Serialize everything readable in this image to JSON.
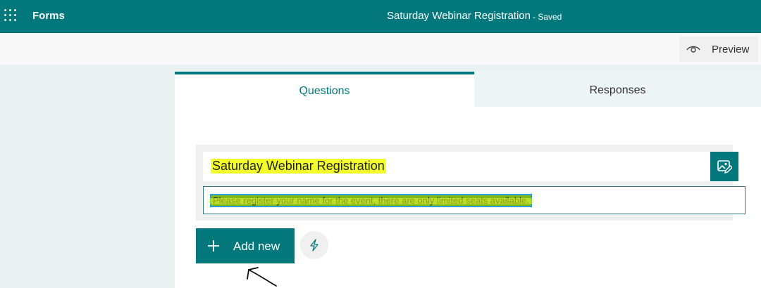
{
  "topbar": {
    "app_name": "Forms",
    "form_title": "Saturday Webinar Registration",
    "status": "- Saved",
    "bg_color": "#03787c",
    "icons": {
      "app_launcher": "waffle-icon"
    }
  },
  "commandbar": {
    "preview_label": "Preview",
    "icons": {
      "preview": "eye-icon"
    }
  },
  "tabs": [
    {
      "label": "Questions",
      "active": true
    },
    {
      "label": "Responses",
      "active": false
    }
  ],
  "form_header": {
    "title": "Saturday Webinar Registration",
    "description": "Please register your name for the event, there are only limited seats available.",
    "theme_button_icon": "image-edit-icon"
  },
  "actions": {
    "add_new_label": "Add new",
    "add_icon": "plus-icon",
    "quick_icon": "lightning-icon"
  },
  "annotation": {
    "icon": "hand-drawn-arrow-icon"
  }
}
